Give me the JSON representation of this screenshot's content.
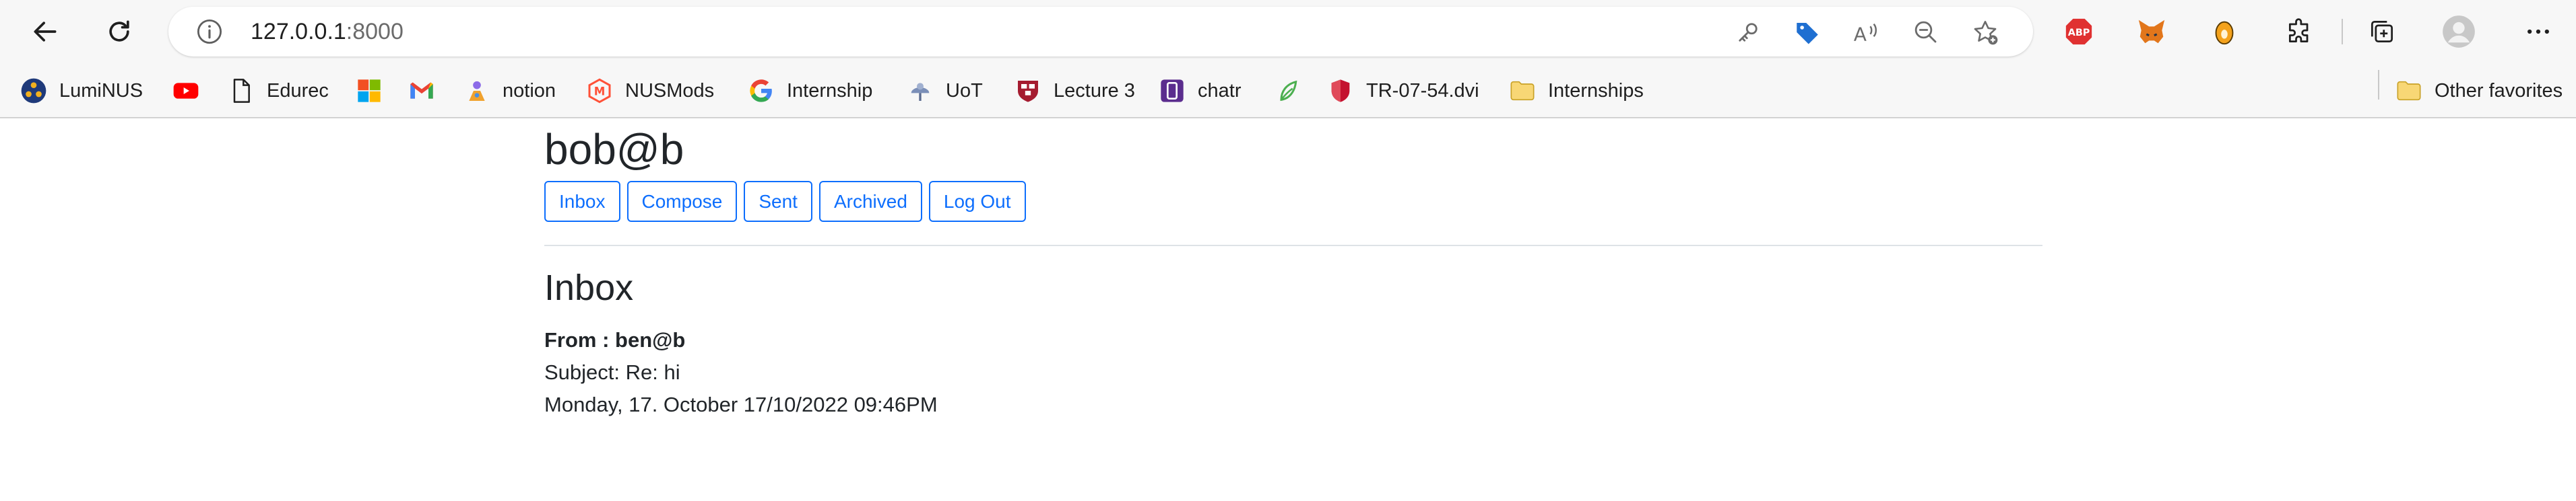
{
  "browser": {
    "url_host": "127.0.0.1",
    "url_port": ":8000",
    "bookmarks": [
      {
        "label": "LumiNUS",
        "icon": "luminus-icon"
      },
      {
        "label": "",
        "icon": "youtube-icon"
      },
      {
        "label": "Edurec",
        "icon": "page-icon"
      },
      {
        "label": "",
        "icon": "microsoft-icon"
      },
      {
        "label": "",
        "icon": "gmail-icon"
      },
      {
        "label": "notion",
        "icon": "notion-icon"
      },
      {
        "label": "NUSMods",
        "icon": "nusmods-icon"
      },
      {
        "label": "Internship",
        "icon": "google-icon"
      },
      {
        "label": "UoT",
        "icon": "uot-icon"
      },
      {
        "label": "Lecture 3",
        "icon": "harvard-icon"
      },
      {
        "label": "chatr",
        "icon": "chatr-icon"
      },
      {
        "label": "",
        "icon": "leaf-icon"
      },
      {
        "label": "TR-07-54.dvi",
        "icon": "shield-icon"
      },
      {
        "label": "Internships",
        "icon": "folder-icon"
      }
    ],
    "other_favorites": "Other favorites",
    "colors": {
      "youtube": "#ff0000",
      "abp": "#e03131",
      "accent": "#0d6efd"
    }
  },
  "page": {
    "user_email": "bob@b",
    "nav": {
      "inbox": "Inbox",
      "compose": "Compose",
      "sent": "Sent",
      "archived": "Archived",
      "logout": "Log Out"
    },
    "section_title": "Inbox",
    "emails": [
      {
        "from": "From : ben@b",
        "subject": "Subject: Re: hi",
        "date": "Monday, 17. October 17/10/2022 09:46PM"
      }
    ]
  }
}
